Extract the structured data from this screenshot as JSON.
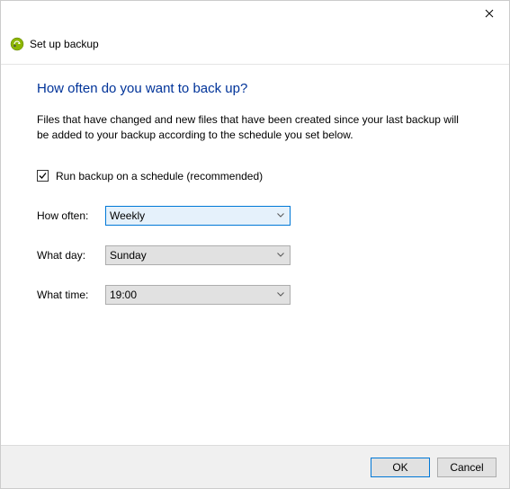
{
  "window": {
    "title": "Set up backup"
  },
  "main": {
    "heading": "How often do you want to back up?",
    "description": "Files that have changed and new files that have been created since your last backup will be added to your backup according to the schedule you set below."
  },
  "schedule": {
    "checkbox_label": "Run backup on a schedule (recommended)",
    "checked": true,
    "how_often_label": "How often:",
    "how_often_value": "Weekly",
    "what_day_label": "What day:",
    "what_day_value": "Sunday",
    "what_time_label": "What time:",
    "what_time_value": "19:00"
  },
  "buttons": {
    "ok": "OK",
    "cancel": "Cancel"
  }
}
